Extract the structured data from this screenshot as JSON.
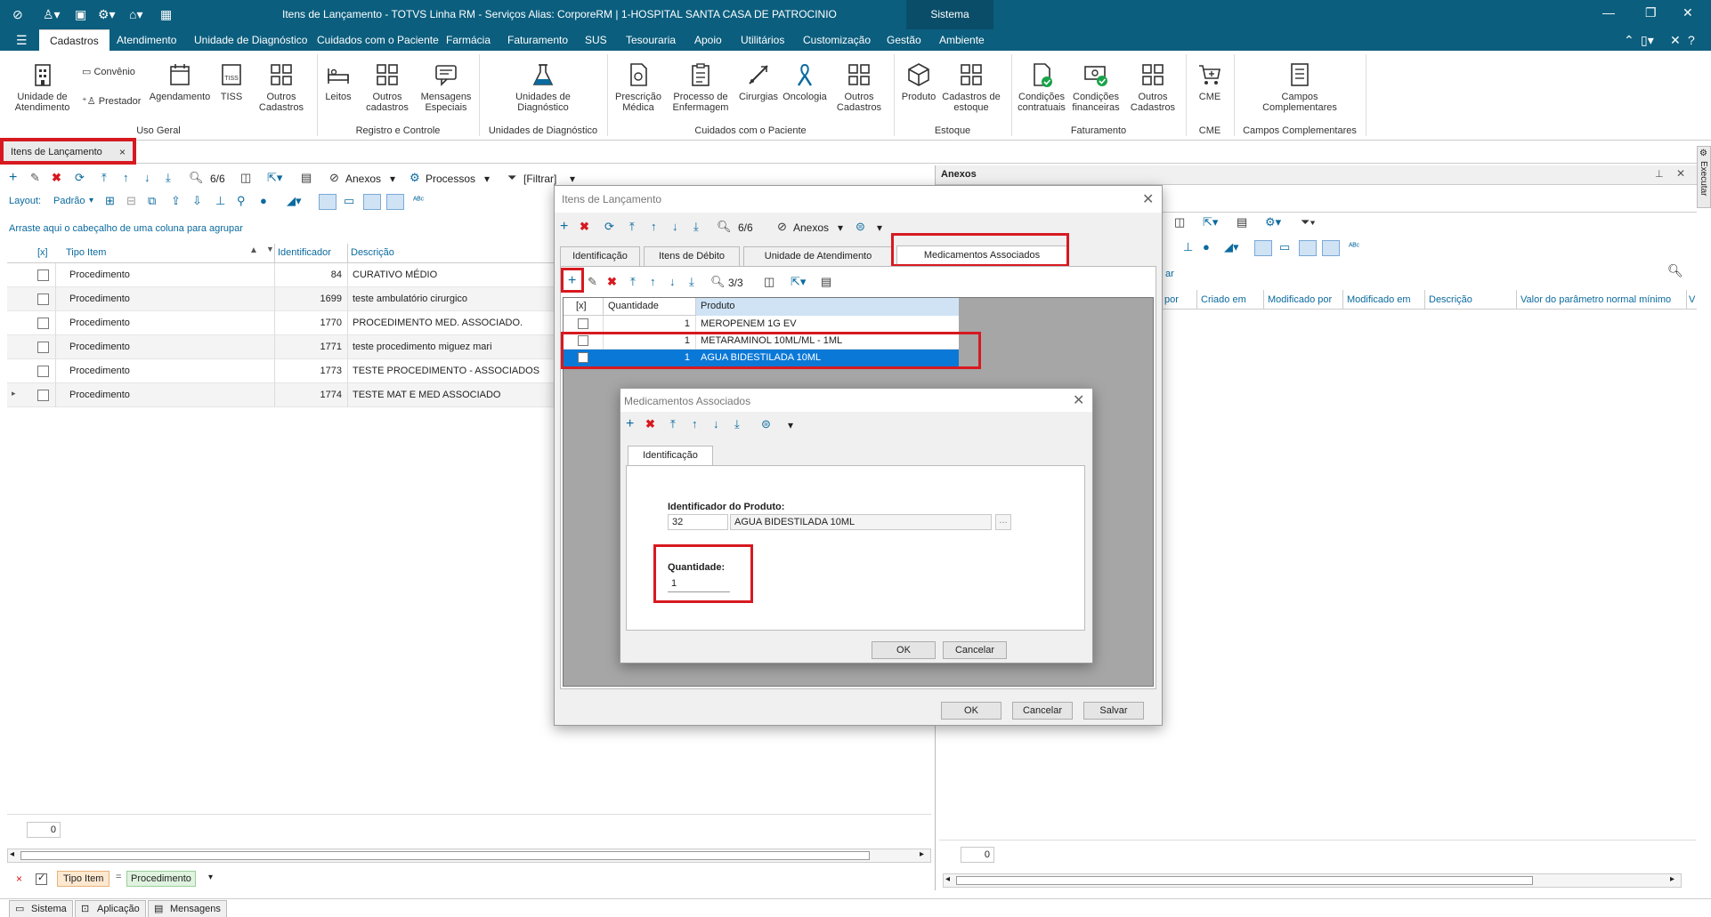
{
  "window": {
    "title": "Itens de Lançamento - TOTVS Linha RM - Serviços  Alias: CorporeRM | 1-HOSPITAL SANTA CASA DE PATROCINIO",
    "system_label": "Sistema"
  },
  "menu": {
    "tabs": [
      "Cadastros",
      "Atendimento",
      "Unidade de Diagnóstico",
      "Cuidados com o Paciente",
      "Farmácia",
      "Faturamento",
      "SUS",
      "Tesouraria",
      "Apoio",
      "Utilitários",
      "Customização",
      "Gestão",
      "Ambiente"
    ],
    "active": "Cadastros"
  },
  "ribbon": {
    "uso_geral": {
      "group": "Uso Geral",
      "unidade_atendimento": "Unidade de Atendimento",
      "convenio": "Convênio",
      "prestador": "Prestador",
      "agendamento": "Agendamento",
      "tiss": "TISS",
      "outros": "Outros Cadastros"
    },
    "registro": {
      "group": "Registro e Controle",
      "leitos": "Leitos",
      "outros": "Outros cadastros",
      "mensagens": "Mensagens Especiais"
    },
    "diagnostico": {
      "group": "Unidades de Diagnóstico",
      "unidades": "Unidades de Diagnóstico"
    },
    "cuidados": {
      "group": "Cuidados com o Paciente",
      "prescricao": "Prescrição Médica",
      "processo": "Processo de Enfermagem",
      "cirurgias": "Cirurgias",
      "oncologia": "Oncologia",
      "outros": "Outros Cadastros"
    },
    "estoque": {
      "group": "Estoque",
      "produto": "Produto",
      "cadastros": "Cadastros de estoque"
    },
    "faturamento": {
      "group": "Faturamento",
      "contratuais": "Condições contratuais",
      "financeiras": "Condições financeiras",
      "outros": "Outros Cadastros"
    },
    "cme": {
      "group": "CME",
      "cme": "CME"
    },
    "campos": {
      "group": "Campos Complementares",
      "campos": "Campos Complementares"
    }
  },
  "doc_tab": {
    "label": "Itens de Lançamento"
  },
  "list": {
    "counter": "6/6",
    "anexos": "Anexos",
    "processos": "Processos",
    "filtrar": "[Filtrar]",
    "layout_label": "Layout:",
    "layout_value": "Padrão",
    "group_hint": "Arraste aqui o cabeçalho de uma coluna para agrupar",
    "columns": {
      "check": "[x]",
      "tipo": "Tipo Item",
      "id": "Identificador",
      "desc": "Descrição"
    },
    "rows": [
      {
        "tipo": "Procedimento",
        "id": "84",
        "desc": "CURATIVO MÉDIO"
      },
      {
        "tipo": "Procedimento",
        "id": "1699",
        "desc": "teste ambulatório cirurgico"
      },
      {
        "tipo": "Procedimento",
        "id": "1770",
        "desc": "PROCEDIMENTO MED. ASSOCIADO."
      },
      {
        "tipo": "Procedimento",
        "id": "1771",
        "desc": "teste procedimento miguez mari"
      },
      {
        "tipo": "Procedimento",
        "id": "1773",
        "desc": "TESTE PROCEDIMENTO - ASSOCIADOS"
      },
      {
        "tipo": "Procedimento",
        "id": "1774",
        "desc": "TESTE MAT E MED ASSOCIADO"
      }
    ],
    "footer_count": "0",
    "filter_field": "Tipo Item",
    "filter_op": "=",
    "filter_value": "Procedimento"
  },
  "anexos_panel": {
    "title": "Anexos",
    "columns": [
      "por",
      "Criado em",
      "Modificado por",
      "Modificado em",
      "Descrição",
      "Valor do parâmetro normal mínimo",
      "V"
    ],
    "partial_text": "ar",
    "footer_count": "0",
    "side_label": "Executar"
  },
  "dialog_main": {
    "title": "Itens de Lançamento",
    "counter": "6/6",
    "anexos": "Anexos",
    "tabs": [
      "Identificação",
      "Itens de Débito",
      "Unidade de Atendimento",
      "Medicamentos Associados"
    ],
    "sub_counter": "3/3",
    "columns": {
      "check": "[x]",
      "qty": "Quantidade",
      "prod": "Produto"
    },
    "rows": [
      {
        "qty": "1",
        "prod": "MEROPENEM 1G EV"
      },
      {
        "qty": "1",
        "prod": "METARAMINOL 10ML/ML - 1ML"
      },
      {
        "qty": "1",
        "prod": "AGUA BIDESTILADA 10ML"
      }
    ],
    "ok": "OK",
    "cancel": "Cancelar",
    "save": "Salvar"
  },
  "dialog_sub": {
    "title": "Medicamentos Associados",
    "tab": "Identificação",
    "prod_label": "Identificador do Produto:",
    "prod_id": "32",
    "prod_name": "AGUA BIDESTILADA 10ML",
    "lookup": "...",
    "qty_label": "Quantidade:",
    "qty_value": "1",
    "ok": "OK",
    "cancel": "Cancelar"
  },
  "statusbar": {
    "sistema": "Sistema",
    "aplicacao": "Aplicação",
    "mensagens": "Mensagens"
  },
  "colors": {
    "title_bg": "#0b5e7e",
    "selection": "#0a78d7",
    "highlight": "#d71920",
    "toolbar_icon": "#0b6a9e"
  }
}
